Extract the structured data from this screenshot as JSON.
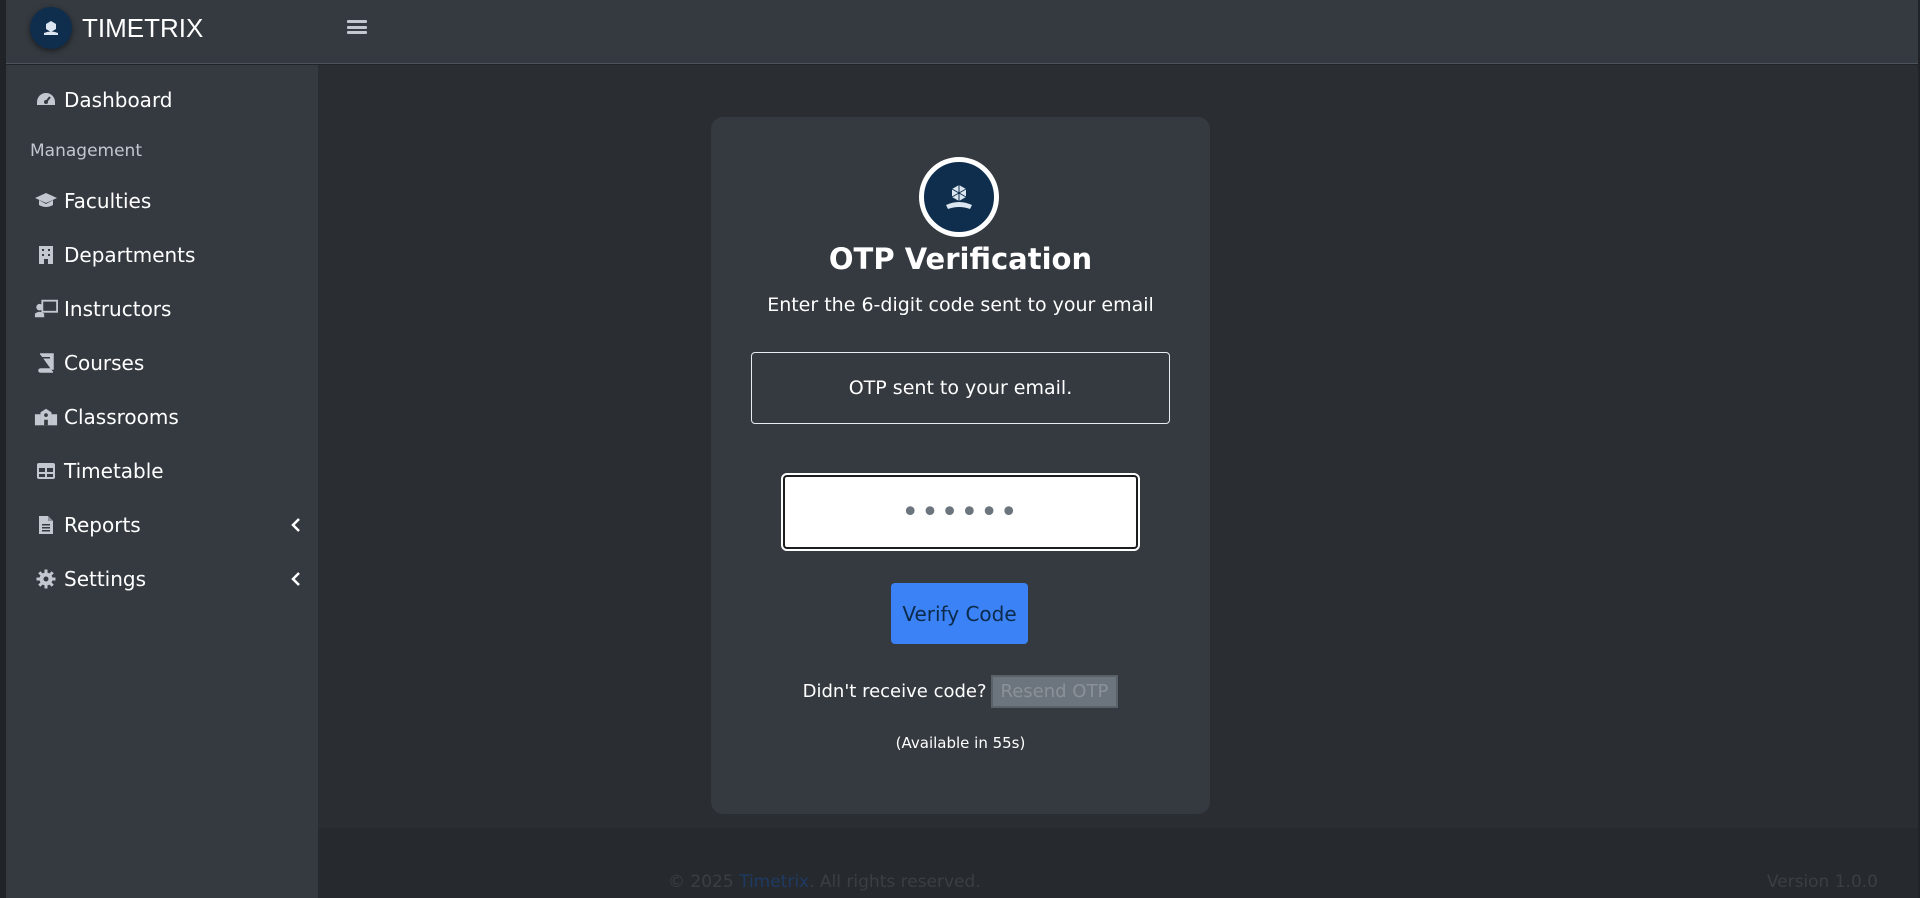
{
  "app": {
    "brand": "TIMETRIX"
  },
  "sidebar": {
    "header": "Management",
    "items": [
      {
        "label": "Dashboard",
        "icon": "tachometer-icon"
      },
      {
        "label": "Faculties",
        "icon": "graduation-cap-icon"
      },
      {
        "label": "Departments",
        "icon": "building-icon"
      },
      {
        "label": "Instructors",
        "icon": "chalkboard-teacher-icon"
      },
      {
        "label": "Courses",
        "icon": "book-icon"
      },
      {
        "label": "Classrooms",
        "icon": "school-icon"
      },
      {
        "label": "Timetable",
        "icon": "table-icon"
      },
      {
        "label": "Reports",
        "icon": "file-icon"
      },
      {
        "label": "Settings",
        "icon": "gear-icon"
      }
    ]
  },
  "card": {
    "title": "OTP Verification",
    "subtitle": "Enter the 6-digit code sent to your email",
    "alert": "OTP sent to your email.",
    "otp_value": "••••••",
    "verify_label": "Verify Code",
    "resend_question": "Didn't receive code?",
    "resend_label": "Resend OTP",
    "available_text": "(Available in 55s)"
  },
  "footer": {
    "copyright": "© 2025",
    "link": "Timetrix",
    "rights": ". All rights reserved.",
    "version": "Version 1.0.0"
  },
  "colors": {
    "accent": "#3b82f6",
    "sidebar_bg": "#343a40",
    "content_bg": "#2a2e33",
    "logo_bg": "#0f2e4d"
  }
}
